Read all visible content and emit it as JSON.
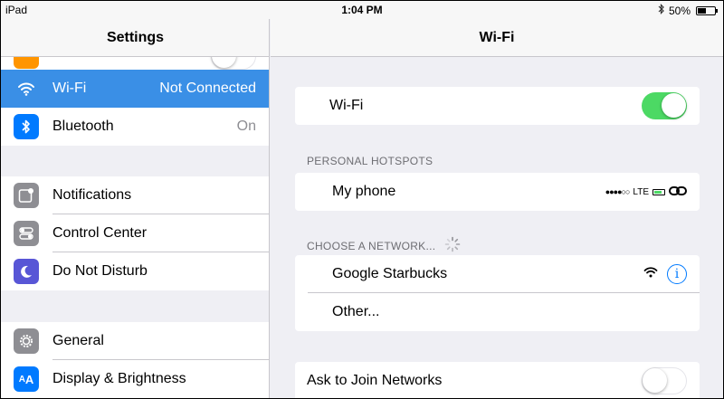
{
  "status_bar": {
    "device": "iPad",
    "time": "1:04 PM",
    "battery": "50%",
    "battery_level": 0.5
  },
  "sidebar": {
    "title": "Settings",
    "items": [
      {
        "label": "Wi-Fi",
        "value": "Not Connected",
        "icon": "wifi-icon",
        "color": "#3a8fe6",
        "selected": true
      },
      {
        "label": "Bluetooth",
        "value": "On",
        "icon": "bluetooth-icon",
        "color": "#007aff"
      },
      {
        "label": "Notifications",
        "value": "",
        "icon": "notifications-icon",
        "color": "#8e8e93"
      },
      {
        "label": "Control Center",
        "value": "",
        "icon": "control-center-icon",
        "color": "#8e8e93"
      },
      {
        "label": "Do Not Disturb",
        "value": "",
        "icon": "moon-icon",
        "color": "#5856d6"
      },
      {
        "label": "General",
        "value": "",
        "icon": "gear-icon",
        "color": "#8e8e93"
      },
      {
        "label": "Display & Brightness",
        "value": "",
        "icon": "display-icon",
        "color": "#007aff"
      }
    ]
  },
  "detail": {
    "title": "Wi-Fi",
    "wifi_label": "Wi-Fi",
    "wifi_on": true,
    "personal_hotspots_header": "PERSONAL HOTSPOTS",
    "hotspot": {
      "name": "My phone",
      "network": "LTE"
    },
    "choose_network_header": "CHOOSE A NETWORK...",
    "networks": [
      {
        "name": "Google Starbucks"
      },
      {
        "name": "Other..."
      }
    ],
    "ask_to_join_label": "Ask to Join Networks",
    "ask_to_join_on": false
  },
  "colors": {
    "accent": "#007aff",
    "selected_row": "#3a8fe6",
    "toggle_on": "#4cd964"
  }
}
